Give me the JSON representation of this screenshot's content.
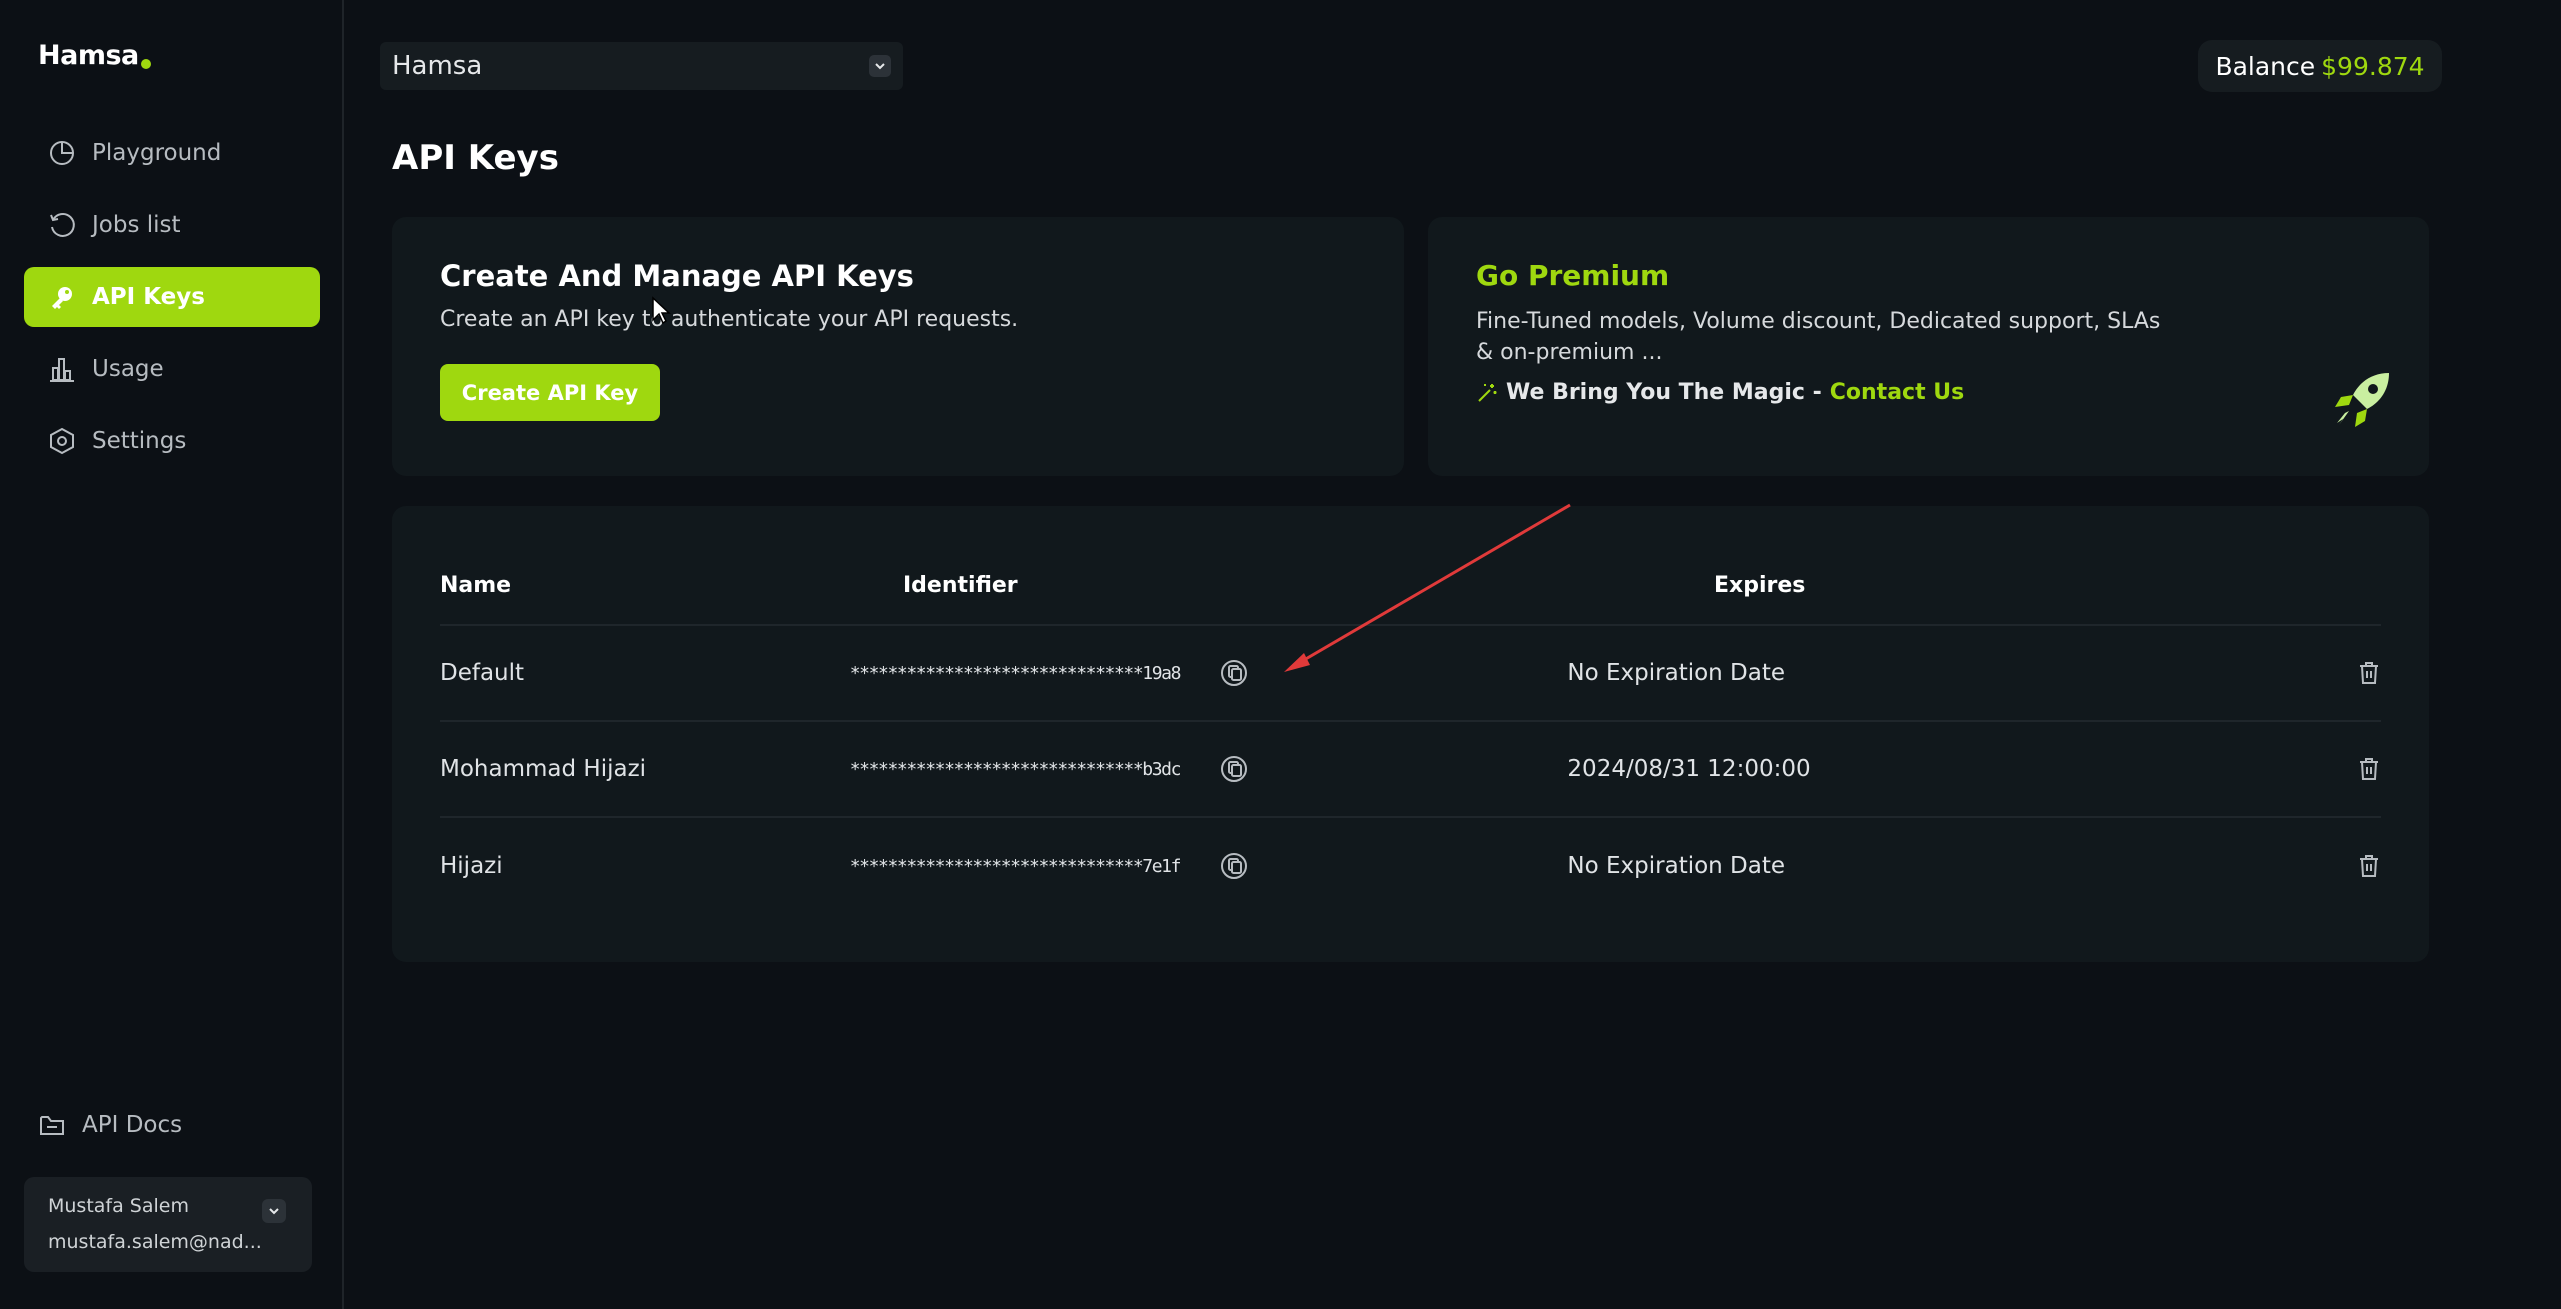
{
  "brand": {
    "name": "Hamsa"
  },
  "sidebar": {
    "items": [
      {
        "label": "Playground",
        "icon": "playground-icon",
        "active": false
      },
      {
        "label": "Jobs list",
        "icon": "history-icon",
        "active": false
      },
      {
        "label": "API Keys",
        "icon": "key-icon",
        "active": true
      },
      {
        "label": "Usage",
        "icon": "bar-chart-icon",
        "active": false
      },
      {
        "label": "Settings",
        "icon": "hexagon-settings-icon",
        "active": false
      }
    ],
    "docs_label": "API Docs",
    "user": {
      "name": "Mustafa Salem",
      "email": "mustafa.salem@nad..."
    }
  },
  "header": {
    "org_selected": "Hamsa",
    "balance_label": "Balance",
    "balance_amount": "$99.874"
  },
  "page": {
    "title": "API Keys"
  },
  "create_card": {
    "title": "Create And Manage API Keys",
    "description": "Create an API key to authenticate your API requests.",
    "button_label": "Create API Key"
  },
  "premium_card": {
    "title": "Go Premium",
    "description": "Fine-Tuned models, Volume discount, Dedicated support, SLAs & on-premium ...",
    "magic_text": "We Bring You The Magic -",
    "contact_label": "Contact Us"
  },
  "keys_table": {
    "columns": [
      "Name",
      "Identifier",
      "Expires"
    ],
    "rows": [
      {
        "name": "Default",
        "identifier": "*******************************19a8",
        "expires": "No Expiration Date"
      },
      {
        "name": "Mohammad Hijazi",
        "identifier": "*******************************b3dc",
        "expires": "2024/08/31 12:00:00"
      },
      {
        "name": "Hijazi",
        "identifier": "*******************************7e1f",
        "expires": "No Expiration Date"
      }
    ]
  },
  "colors": {
    "accent": "#9fd80f",
    "background": "#0c1015",
    "card": "#11181c",
    "annotation_arrow": "#e03a3a"
  }
}
